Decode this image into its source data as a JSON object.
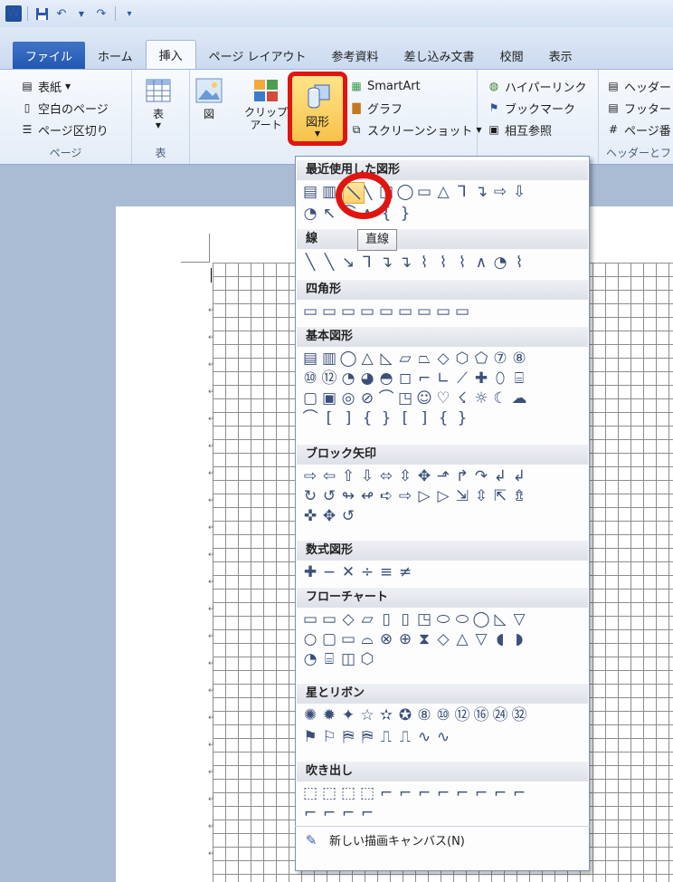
{
  "qat": {
    "logo": "W",
    "undo_glyph": "↶",
    "redo_glyph": "↷"
  },
  "tabs": [
    "ファイル",
    "ホーム",
    "挿入",
    "ページ レイアウト",
    "参考資料",
    "差し込み文書",
    "校閲",
    "表示"
  ],
  "ribbon": {
    "page_group": {
      "cover": "表紙",
      "blank": "空白のページ",
      "break": "ページ区切り",
      "label": "ページ"
    },
    "table_group": {
      "table": "表",
      "label": "表"
    },
    "illustrations": {
      "picture": "図",
      "clipart": "クリップアート",
      "shapes": "図形"
    },
    "smartart": "SmartArt",
    "chart": "グラフ",
    "screenshot": "スクリーンショット",
    "links": {
      "hyperlink": "ハイパーリンク",
      "bookmark": "ブックマーク",
      "crossref": "相互参照"
    },
    "header_footer": {
      "header": "ヘッダー",
      "footer": "フッター",
      "page_number": "ページ番",
      "label": "ヘッダーとフ"
    }
  },
  "dropdown": {
    "categories": [
      "最近使用した図形",
      "線",
      "四角形",
      "基本図形",
      "ブロック矢印",
      "数式図形",
      "フローチャート",
      "星とリボン",
      "吹き出し"
    ],
    "tooltip": "直線",
    "new_canvas": "新しい描画キャンバス(N)",
    "rows": {
      "recent1": [
        "▤",
        "▥",
        "╲",
        "╲",
        "□",
        "◯",
        "▭",
        "△",
        "⅂",
        "↴",
        "⇨",
        "⇩"
      ],
      "recent2": [
        "◔",
        "↖",
        "⌒",
        "∧",
        "{",
        "}"
      ],
      "lines": [
        "╲",
        "╲",
        "↘",
        "⅂",
        "↴",
        "↴",
        "⌇",
        "⌇",
        "⌇",
        "∧",
        "◔",
        "⌇"
      ],
      "rect": [
        "▭",
        "▭",
        "▭",
        "▭",
        "▭",
        "▭",
        "▭",
        "▭",
        "▭"
      ],
      "basic1": [
        "▤",
        "▥",
        "◯",
        "△",
        "◺",
        "▱",
        "⏢",
        "◇",
        "⬡",
        "⬠",
        "⑦",
        "⑧"
      ],
      "basic2": [
        "⑩",
        "⑫",
        "◔",
        "◕",
        "◓",
        "◻",
        "⌐",
        "∟",
        "⟋",
        "✚",
        "⬯",
        "⌸"
      ],
      "basic3": [
        "▢",
        "▣",
        "◎",
        "⊘",
        "⌒",
        "◳",
        "☺",
        "♡",
        "☇",
        "☼",
        "☾",
        "☁"
      ],
      "basic4": [
        "⌒",
        "[",
        "]",
        "{",
        "}",
        "[",
        "]",
        "{",
        "}"
      ],
      "arrows1": [
        "⇨",
        "⇦",
        "⇧",
        "⇩",
        "⬄",
        "⇳",
        "✥",
        "⬏",
        "↱",
        "↷",
        "↲",
        "↲"
      ],
      "arrows2": [
        "↻",
        "↺",
        "↬",
        "↫",
        "➪",
        "⇨",
        "▷",
        "▷",
        "⇲",
        "⇳",
        "⇱",
        "⇯"
      ],
      "arrows3": [
        "✜",
        "✥",
        "↺"
      ],
      "math": [
        "✚",
        "−",
        "✕",
        "÷",
        "≡",
        "≠"
      ],
      "flow1": [
        "▭",
        "▭",
        "◇",
        "▱",
        "▯",
        "▯",
        "◳",
        "⬭",
        "⬭",
        "◯",
        "◺",
        "▽"
      ],
      "flow2": [
        "○",
        "▢",
        "▭",
        "⌓",
        "⊗",
        "⊕",
        "⧗",
        "◇",
        "△",
        "▽",
        "◖",
        "◗"
      ],
      "flow3": [
        "◔",
        "⌸",
        "◫",
        "⬡"
      ],
      "stars1": [
        "✺",
        "✹",
        "✦",
        "☆",
        "✫",
        "✪",
        "⑧",
        "⑩",
        "⑫",
        "⑯",
        "㉔",
        "㉜"
      ],
      "stars2": [
        "⚑",
        "⚐",
        "⛿",
        "⛿",
        "⎍",
        "⎍",
        "∿",
        "∿"
      ],
      "callout1": [
        "⬚",
        "⬚",
        "⬚",
        "⬚",
        "⌐",
        "⌐",
        "⌐",
        "⌐",
        "⌐",
        "⌐",
        "⌐",
        "⌐"
      ],
      "callout2": [
        "⌐",
        "⌐",
        "⌐",
        "⌐"
      ]
    }
  }
}
